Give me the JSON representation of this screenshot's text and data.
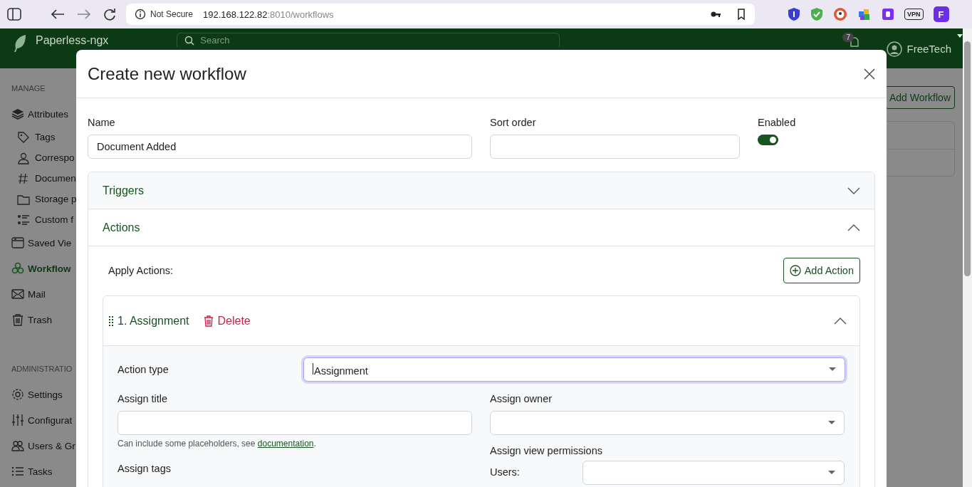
{
  "browser": {
    "security_label": "Not Secure",
    "url_host": "192.168.122.82",
    "url_path": ":8010/workflows",
    "vpn_label": "VPN",
    "profile_initial": "F"
  },
  "app": {
    "name": "Paperless-ngx",
    "search_placeholder": "Search",
    "notification_count": "7",
    "user": "FreeTech"
  },
  "sidebar": {
    "sections": [
      {
        "heading": "MANAGE",
        "items": [
          {
            "label": "Attributes",
            "selected": false,
            "children": [
              {
                "label": "Tags",
                "selected": false
              },
              {
                "label": "Correspo",
                "selected": false
              },
              {
                "label": "Documen",
                "selected": false
              },
              {
                "label": "Storage p",
                "selected": false
              },
              {
                "label": "Custom f",
                "selected": false
              }
            ]
          },
          {
            "label": "Saved Vie",
            "selected": false
          },
          {
            "label": "Workflow",
            "selected": true
          },
          {
            "label": "Mail",
            "selected": false
          },
          {
            "label": "Trash",
            "selected": false
          }
        ]
      },
      {
        "heading": "ADMINISTRATIO",
        "items": [
          {
            "label": "Settings",
            "selected": false
          },
          {
            "label": "Configurat",
            "selected": false
          },
          {
            "label": "Users & Gr",
            "selected": false
          },
          {
            "label": "Tasks",
            "selected": false
          }
        ]
      }
    ]
  },
  "page": {
    "add_button": "Add Workflow"
  },
  "modal": {
    "title": "Create new workflow",
    "fields": [
      {
        "label": "Name",
        "value": "Document Added"
      },
      {
        "label": "Sort order"
      }
    ],
    "enabled": {
      "label": "Enabled",
      "on": true
    },
    "sections": [
      {
        "title": "Triggers",
        "expanded": false
      },
      {
        "title": "Actions",
        "expanded": true
      }
    ],
    "apply_label": "Apply Actions:",
    "add_action": "Add Action",
    "actions": [
      {
        "title": "1. Assignment",
        "delete": "Delete",
        "expanded": true,
        "action_type_label": "Action type",
        "action_type": "Assignment",
        "action_type_focused": true,
        "assign_title_label": "Assign title",
        "help_text": "Can include some placeholders, see ",
        "help_link": "documentation",
        "help_end": ".",
        "assign_tags_label": "Assign tags",
        "assign_owner_label": "Assign owner",
        "view_permissions_label": "Assign view permissions",
        "users_label": "Users:"
      }
    ]
  }
}
